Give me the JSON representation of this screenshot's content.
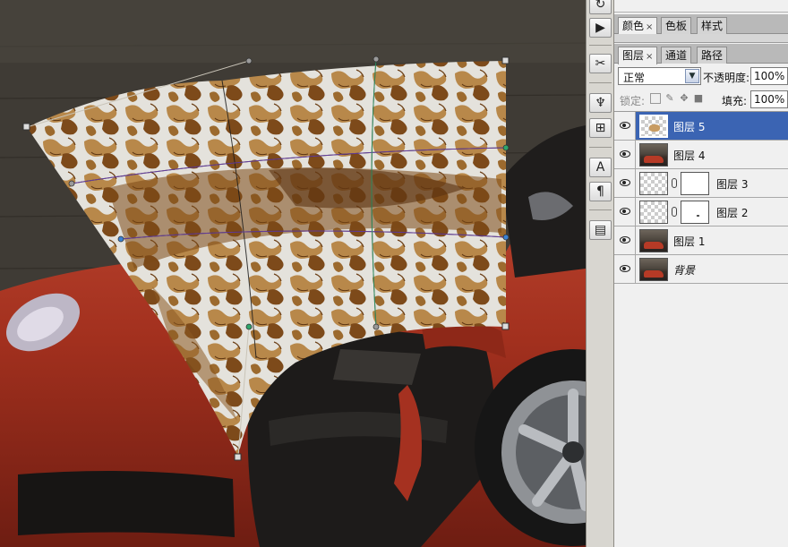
{
  "panels": {
    "top_tabs": [
      {
        "label": "颜色",
        "active": true,
        "closable": true
      },
      {
        "label": "色板",
        "active": false,
        "closable": false
      },
      {
        "label": "样式",
        "active": false,
        "closable": false
      }
    ],
    "layer_tabs": [
      {
        "label": "图层",
        "active": true,
        "closable": true
      },
      {
        "label": "通道",
        "active": false,
        "closable": false
      },
      {
        "label": "路径",
        "active": false,
        "closable": false
      }
    ],
    "blend_mode": "正常",
    "opacity_label": "不透明度:",
    "opacity_value": "100%",
    "lock_label": "锁定:",
    "fill_label": "填充:",
    "fill_value": "100%",
    "layers": [
      {
        "name": "图层 5",
        "selected": true,
        "visible": true,
        "thumb": "texture",
        "mask": false,
        "italic": false
      },
      {
        "name": "图层 4",
        "selected": false,
        "visible": true,
        "thumb": "car",
        "mask": false,
        "italic": false
      },
      {
        "name": "图层 3",
        "selected": false,
        "visible": true,
        "thumb": "transparent",
        "mask": true,
        "italic": false
      },
      {
        "name": "图层 2",
        "selected": false,
        "visible": true,
        "thumb": "transparent",
        "mask": true,
        "italic": false
      },
      {
        "name": "图层 1",
        "selected": false,
        "visible": true,
        "thumb": "car",
        "mask": false,
        "italic": false
      },
      {
        "name": "背景",
        "selected": false,
        "visible": true,
        "thumb": "car",
        "mask": false,
        "italic": true
      }
    ]
  },
  "tools": [
    {
      "icon": "history-icon",
      "glyph": "↻"
    },
    {
      "icon": "actions-play-icon",
      "glyph": "▶"
    },
    {
      "icon": "tool-presets-icon",
      "glyph": "✂"
    },
    {
      "icon": "brushes-icon",
      "glyph": "♆"
    },
    {
      "icon": "clone-source-icon",
      "glyph": "⊞"
    },
    {
      "icon": "character-icon",
      "glyph": "A"
    },
    {
      "icon": "paragraph-icon",
      "glyph": "¶"
    },
    {
      "icon": "layer-comps-icon",
      "glyph": "▤"
    }
  ],
  "colors": {
    "selection_blue": "#3b64b3",
    "car_red": "#b63a26",
    "texture_rust": "#8a5a22",
    "texture_white": "#e8e6e0"
  }
}
